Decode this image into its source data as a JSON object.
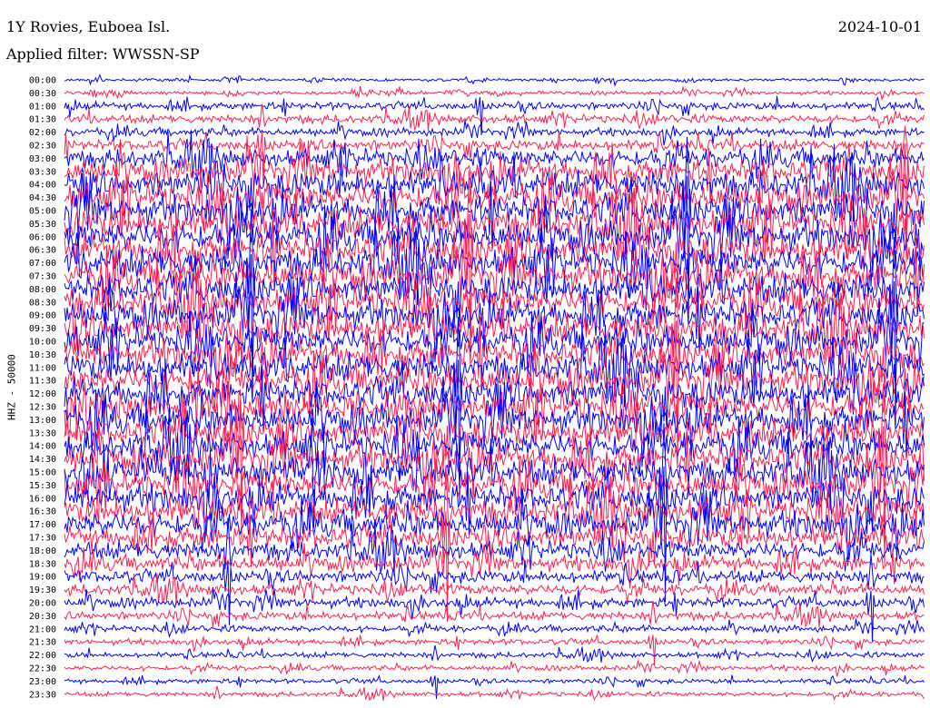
{
  "header": {
    "station": "1Y Rovies, Euboea Isl.",
    "filter": "Applied filter: WWSSN-SP",
    "date": "2024-10-01"
  },
  "colors": {
    "background": "#ffffff",
    "trace_a": "#0000ff",
    "trace_b": "#ff1f4f",
    "text": "#000000"
  },
  "chart_data": {
    "type": "line",
    "ylabel": "HHZ - 50000",
    "row_labels": [
      "00:00",
      "00:30",
      "01:00",
      "01:30",
      "02:00",
      "02:30",
      "03:00",
      "03:30",
      "04:00",
      "04:30",
      "05:00",
      "05:30",
      "06:00",
      "06:30",
      "07:00",
      "07:30",
      "08:00",
      "08:30",
      "09:00",
      "09:30",
      "10:00",
      "10:30",
      "11:00",
      "11:30",
      "12:00",
      "12:30",
      "13:00",
      "13:30",
      "14:00",
      "14:30",
      "15:00",
      "15:30",
      "16:00",
      "16:30",
      "17:00",
      "17:30",
      "18:00",
      "18:30",
      "19:00",
      "19:30",
      "20:00",
      "20:30",
      "21:00",
      "21:30",
      "22:00",
      "22:30",
      "23:00",
      "23:30"
    ],
    "row_colors": [
      "blue",
      "red"
    ],
    "relative_amplitude": [
      0.35,
      0.45,
      0.9,
      1.0,
      0.95,
      1.3,
      2.2,
      2.8,
      3.2,
      3.4,
      3.5,
      3.6,
      3.6,
      3.6,
      3.6,
      3.5,
      3.5,
      3.4,
      3.4,
      3.4,
      3.4,
      3.4,
      3.4,
      3.4,
      3.4,
      3.4,
      3.4,
      3.3,
      3.3,
      3.3,
      3.3,
      3.2,
      3.2,
      3.1,
      3.0,
      2.6,
      2.2,
      1.8,
      1.5,
      1.3,
      1.2,
      1.0,
      0.8,
      0.7,
      0.65,
      0.6,
      0.55,
      0.55
    ]
  }
}
